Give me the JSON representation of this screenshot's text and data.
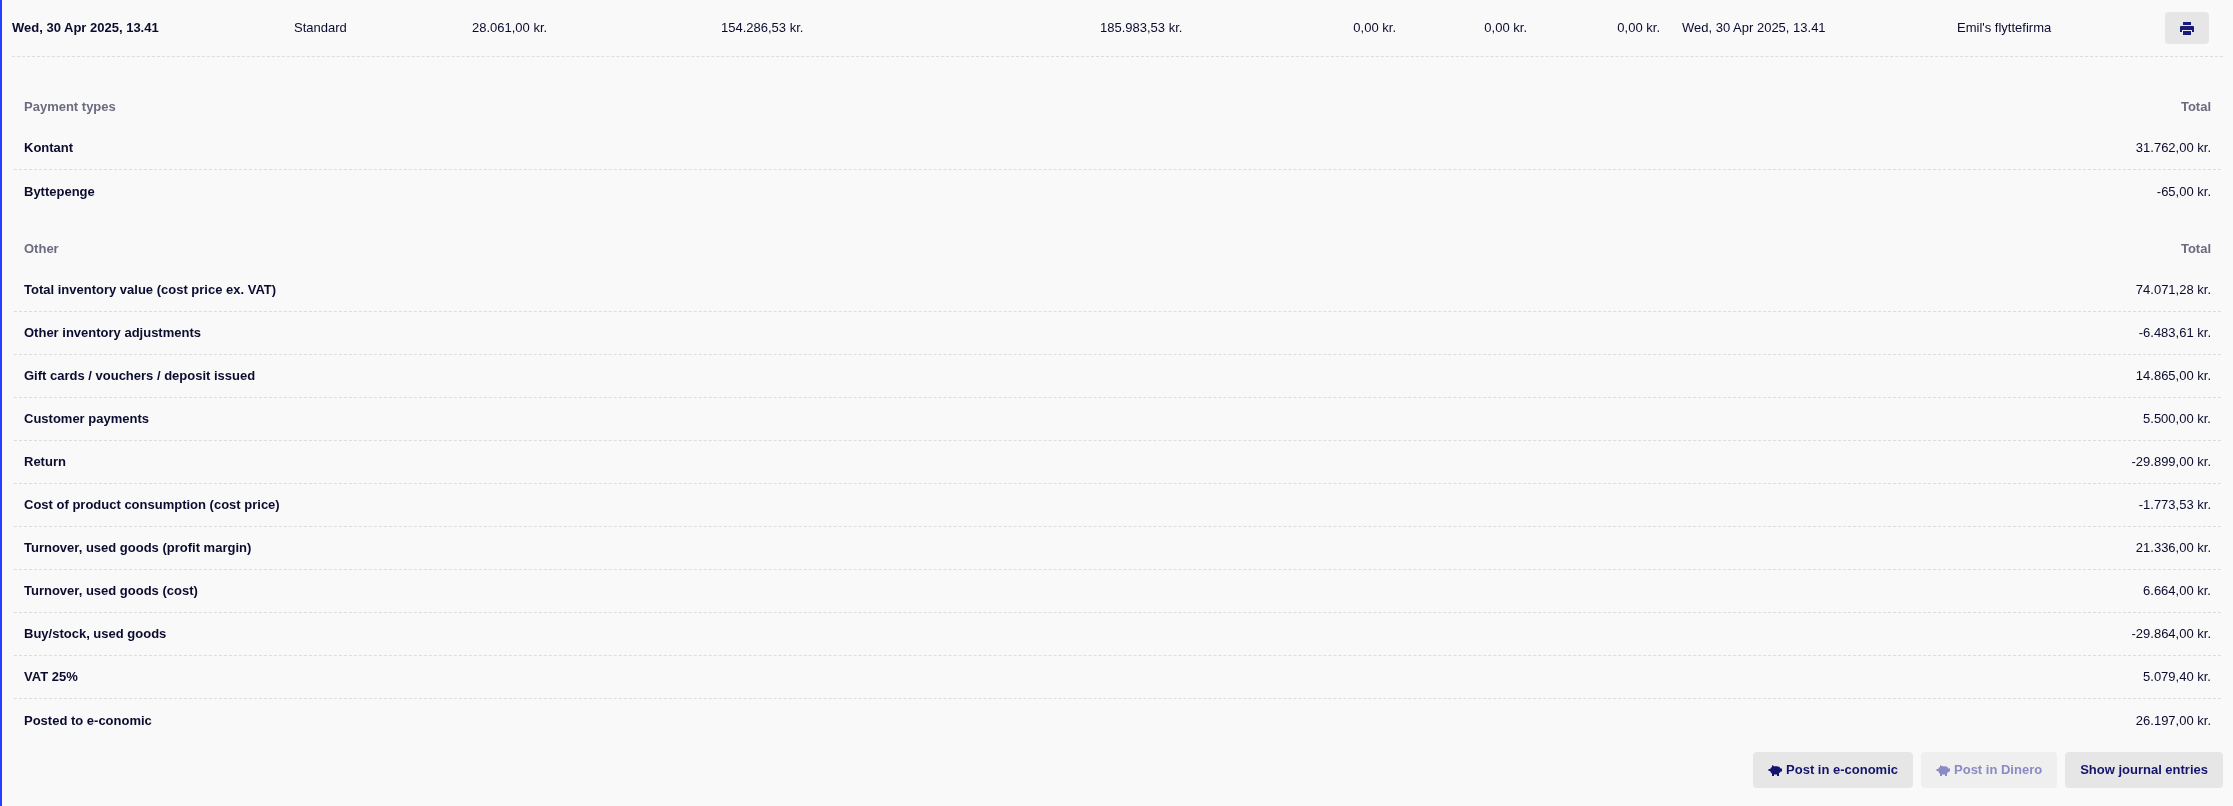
{
  "summary_row": {
    "cells": [
      "Wed, 30 Apr 2025, 13.41",
      "Standard",
      "28.061,00 kr.",
      "154.286,53 kr.",
      "185.983,53 kr.",
      "0,00 kr.",
      "0,00 kr.",
      "0,00 kr.",
      "Wed, 30 Apr 2025, 13.41",
      "Emil's flyttefirma"
    ]
  },
  "sections": [
    {
      "heading": "Payment types",
      "total_heading": "Total",
      "rows": [
        {
          "label": "Kontant",
          "value": "31.762,00 kr."
        },
        {
          "label": "Byttepenge",
          "value": "-65,00 kr."
        }
      ]
    },
    {
      "heading": "Other",
      "total_heading": "Total",
      "rows": [
        {
          "label": "Total inventory value (cost price ex. VAT)",
          "value": "74.071,28 kr."
        },
        {
          "label": "Other inventory adjustments",
          "value": "-6.483,61 kr."
        },
        {
          "label": "Gift cards / vouchers / deposit issued",
          "value": "14.865,00 kr."
        },
        {
          "label": "Customer payments",
          "value": "5.500,00 kr."
        },
        {
          "label": "Return",
          "value": "-29.899,00 kr."
        },
        {
          "label": "Cost of product consumption (cost price)",
          "value": "-1.773,53 kr."
        },
        {
          "label": "Turnover, used goods (profit margin)",
          "value": "21.336,00 kr."
        },
        {
          "label": "Turnover, used goods (cost)",
          "value": "6.664,00 kr."
        },
        {
          "label": "Buy/stock, used goods",
          "value": "-29.864,00 kr."
        },
        {
          "label": "VAT 25%",
          "value": "5.079,40 kr."
        },
        {
          "label": "Posted to e-conomic",
          "value": "26.197,00 kr."
        }
      ]
    }
  ],
  "buttons": [
    {
      "kind": "piggy",
      "label": "Post in e-conomic",
      "disabled": false
    },
    {
      "kind": "piggy",
      "label": "Post in Dinero",
      "disabled": true
    },
    {
      "kind": "plain",
      "label": "Show journal entries",
      "disabled": false
    }
  ]
}
